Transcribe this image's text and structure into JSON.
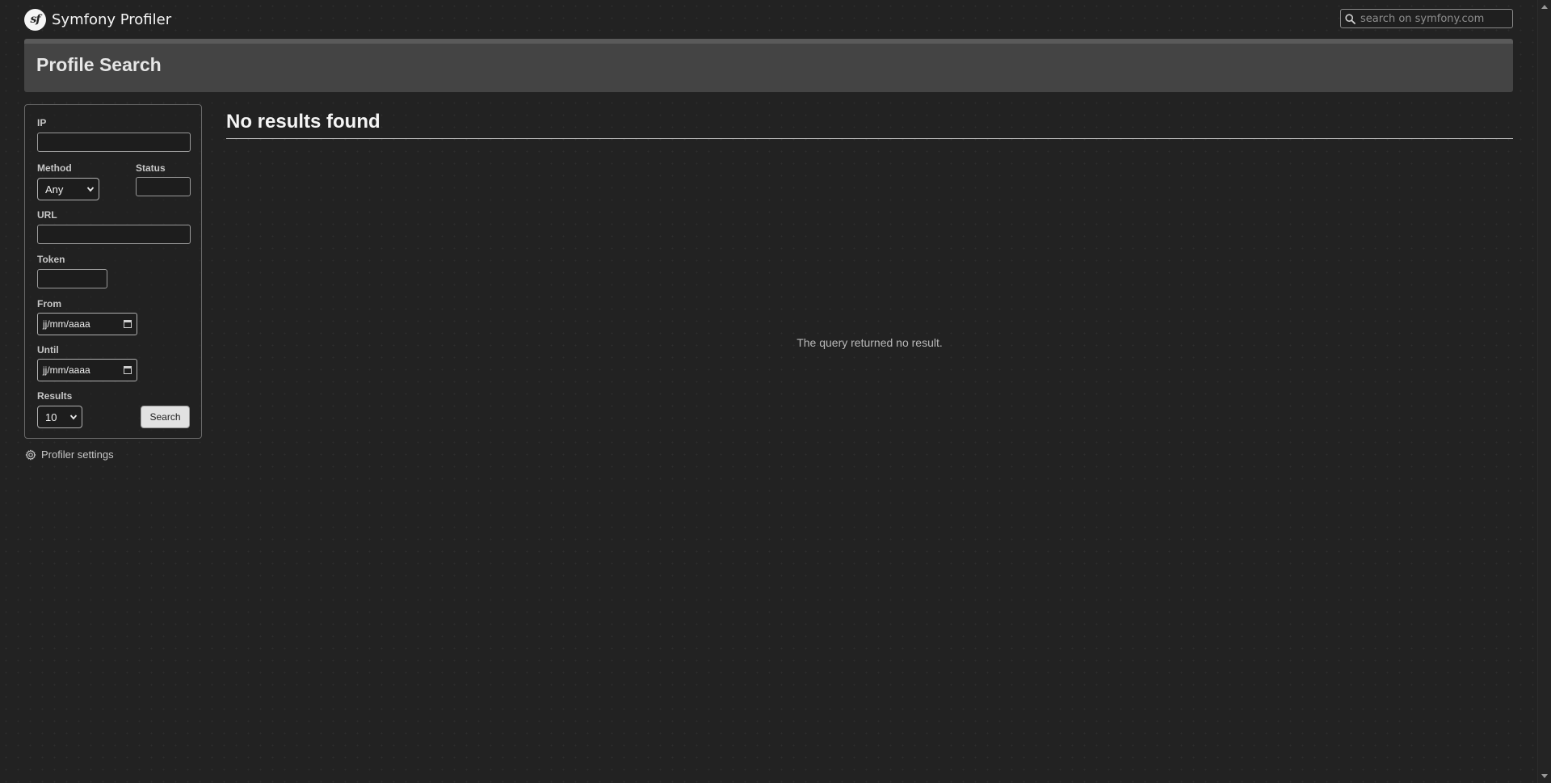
{
  "header": {
    "brand": "Symfony Profiler",
    "logo_text": "sf",
    "search_placeholder": "search on symfony.com"
  },
  "summary": {
    "title": "Profile Search"
  },
  "form": {
    "ip_label": "IP",
    "ip_value": "",
    "method_label": "Method",
    "method_value": "Any",
    "status_label": "Status",
    "status_value": "",
    "url_label": "URL",
    "url_value": "",
    "token_label": "Token",
    "token_value": "",
    "from_label": "From",
    "from_value": "jj/mm/aaaa",
    "until_label": "Until",
    "until_value": "jj/mm/aaaa",
    "results_label": "Results",
    "results_value": "10",
    "search_button": "Search"
  },
  "sidebar_links": {
    "settings": "Profiler settings"
  },
  "main": {
    "title": "No results found",
    "empty_message": "The query returned no result."
  }
}
